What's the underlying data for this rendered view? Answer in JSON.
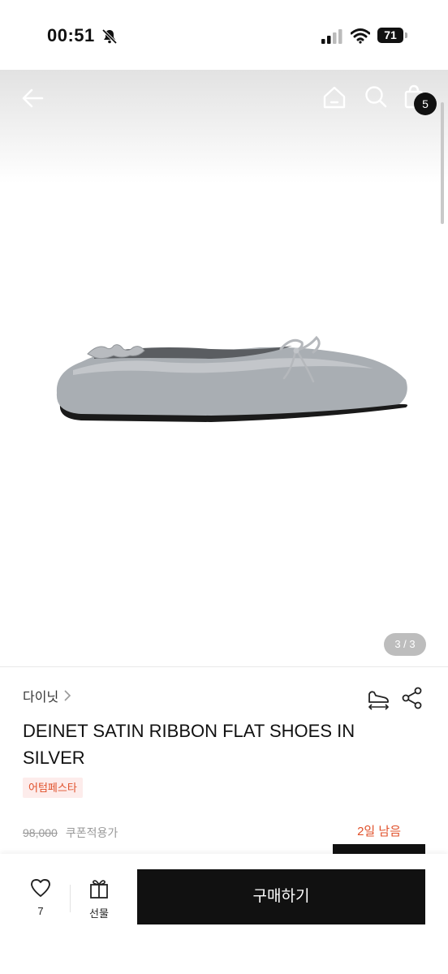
{
  "status_bar": {
    "time": "00:51",
    "battery": "71"
  },
  "header": {
    "cart_count": "5"
  },
  "gallery": {
    "page_indicator": "3 / 3"
  },
  "product": {
    "brand": "다이닛",
    "title": "DEINET SATIN RIBBON FLAT SHOES IN SILVER",
    "event_tag": "어텀페스타",
    "original_price": "98,000",
    "coupon_note": "쿠폰적용가",
    "days_left": "2일 남음"
  },
  "bottom_bar": {
    "like_count": "7",
    "gift_label": "선물",
    "buy_label": "구매하기"
  }
}
